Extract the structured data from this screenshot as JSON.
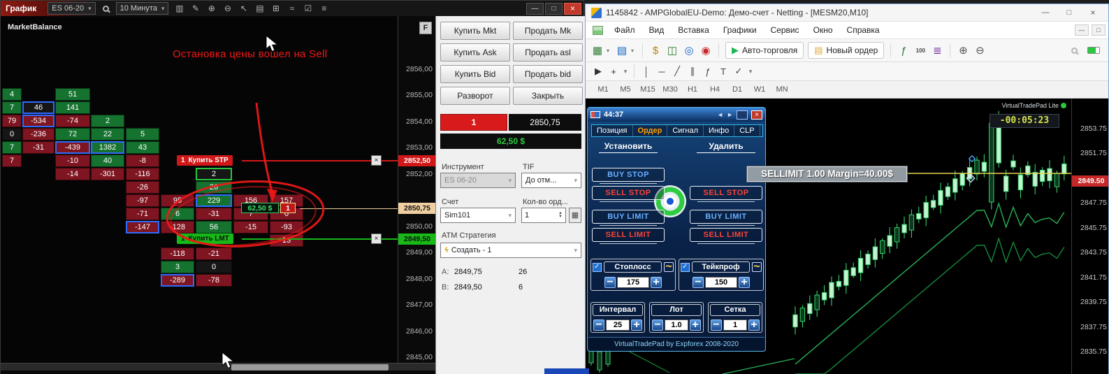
{
  "colors": {
    "annotation_red": "#f01818",
    "pnl_green": "#2ecc40",
    "buy_blue": "#6ab0ff",
    "sell_red": "#ff4438",
    "stp_red": "#d01818",
    "lmt_green": "#17b817",
    "marker_tan": "#f0d0a0",
    "cell_green": "#15722f",
    "cell_red": "#7e1520",
    "highlight_blue": "#2f6bff",
    "mt5_candle_green": "#35d06a",
    "countdown_yellow": "#d7e34d"
  },
  "left_window": {
    "title": "График",
    "instrument": "ES 06-20",
    "timeframe": "10 Минута",
    "panel_label": "MarketBalance",
    "f_button": "F",
    "annotation": "Остановка цены вошел на Sell",
    "tool_icons": [
      {
        "name": "chart-style-icon",
        "glyph": "▥"
      },
      {
        "name": "draw-icon",
        "glyph": "✎"
      },
      {
        "name": "zoom-in-icon",
        "glyph": "⊕"
      },
      {
        "name": "zoom-out-icon",
        "glyph": "⊖"
      },
      {
        "name": "pointer-icon",
        "glyph": "↖"
      },
      {
        "name": "report-icon",
        "glyph": "▤"
      },
      {
        "name": "window-grid-icon",
        "glyph": "⊞"
      },
      {
        "name": "indicator-icon",
        "glyph": "≈"
      },
      {
        "name": "region-icon",
        "glyph": "☑"
      },
      {
        "name": "list-icon",
        "glyph": "≡"
      }
    ],
    "axis_prices": [
      "2856,00",
      "2855,00",
      "2854,00",
      "2853,00",
      "2852,00",
      "2850,00",
      "2849,00",
      "2848,00",
      "2847,00",
      "2846,00",
      "2845,00"
    ],
    "markers": {
      "stp_qty": "1",
      "stp_label": "Купить STP",
      "stp_price": "2852,50",
      "current_price": "2850,75",
      "lmt_qty": "1",
      "lmt_label": "Купить LMT",
      "lmt_price": "2849,50",
      "tooltip_pnl": "62,50 $",
      "tooltip_qty": "1"
    },
    "cells": [
      {
        "v": "4",
        "c": 0,
        "r": 0,
        "k": "g"
      },
      {
        "v": "51",
        "c": 2,
        "r": 0,
        "k": "g"
      },
      {
        "v": "7",
        "c": 0,
        "r": 1,
        "k": "g"
      },
      {
        "v": "46",
        "c": 1,
        "r": 1,
        "k": "d",
        "b": 1
      },
      {
        "v": "141",
        "c": 2,
        "r": 1,
        "k": "g"
      },
      {
        "v": "79",
        "c": 0,
        "r": 2,
        "k": "r"
      },
      {
        "v": "-534",
        "c": 1,
        "r": 2,
        "k": "r",
        "b": 1
      },
      {
        "v": "-74",
        "c": 2,
        "r": 2,
        "k": "r"
      },
      {
        "v": "2",
        "c": 3,
        "r": 2,
        "k": "g"
      },
      {
        "v": "0",
        "c": 0,
        "r": 3,
        "k": "d"
      },
      {
        "v": "-236",
        "c": 1,
        "r": 3,
        "k": "r"
      },
      {
        "v": "72",
        "c": 2,
        "r": 3,
        "k": "g"
      },
      {
        "v": "22",
        "c": 3,
        "r": 3,
        "k": "g"
      },
      {
        "v": "5",
        "c": 4,
        "r": 3,
        "k": "g"
      },
      {
        "v": "7",
        "c": 0,
        "r": 4,
        "k": "g"
      },
      {
        "v": "-31",
        "c": 1,
        "r": 4,
        "k": "r"
      },
      {
        "v": "-439",
        "c": 2,
        "r": 4,
        "k": "r",
        "b": 1
      },
      {
        "v": "1382",
        "c": 3,
        "r": 4,
        "k": "g",
        "b": 1
      },
      {
        "v": "43",
        "c": 4,
        "r": 4,
        "k": "g"
      },
      {
        "v": "7",
        "c": 0,
        "r": 5,
        "k": "r"
      },
      {
        "v": "-10",
        "c": 2,
        "r": 5,
        "k": "r"
      },
      {
        "v": "40",
        "c": 3,
        "r": 5,
        "k": "g"
      },
      {
        "v": "-8",
        "c": 4,
        "r": 5,
        "k": "r"
      },
      {
        "v": "-14",
        "c": 2,
        "r": 6,
        "k": "r"
      },
      {
        "v": "-301",
        "c": 3,
        "r": 6,
        "k": "r"
      },
      {
        "v": "-116",
        "c": 4,
        "r": 6,
        "k": "r"
      },
      {
        "v": "2",
        "c": 6,
        "r": 6,
        "k": "d",
        "gb": 1
      },
      {
        "v": "-26",
        "c": 4,
        "r": 7,
        "k": "r"
      },
      {
        "v": "26",
        "c": 6,
        "r": 7,
        "k": "g"
      },
      {
        "v": "-97",
        "c": 4,
        "r": 8,
        "k": "r"
      },
      {
        "v": "95",
        "c": 5,
        "r": 8,
        "k": "r"
      },
      {
        "v": "229",
        "c": 6,
        "r": 8,
        "k": "g",
        "b": 1
      },
      {
        "v": "156",
        "c": 7,
        "r": 8,
        "k": "r"
      },
      {
        "v": "157",
        "c": 8,
        "r": 8,
        "k": "r"
      },
      {
        "v": "-71",
        "c": 4,
        "r": 9,
        "k": "r"
      },
      {
        "v": "6",
        "c": 5,
        "r": 9,
        "k": "g"
      },
      {
        "v": "-31",
        "c": 6,
        "r": 9,
        "k": "r"
      },
      {
        "v": "7",
        "c": 7,
        "r": 9,
        "k": "r"
      },
      {
        "v": "0",
        "c": 8,
        "r": 9,
        "k": "r"
      },
      {
        "v": "-147",
        "c": 4,
        "r": 10,
        "k": "r",
        "b": 1
      },
      {
        "v": "-128",
        "c": 5,
        "r": 10,
        "k": "r"
      },
      {
        "v": "56",
        "c": 6,
        "r": 10,
        "k": "g"
      },
      {
        "v": "-15",
        "c": 7,
        "r": 10,
        "k": "r"
      },
      {
        "v": "-93",
        "c": 8,
        "r": 10,
        "k": "r"
      },
      {
        "v": "13",
        "c": 8,
        "r": 11,
        "k": "r"
      },
      {
        "v": "-118",
        "c": 5,
        "r": 12,
        "k": "r"
      },
      {
        "v": "-21",
        "c": 6,
        "r": 12,
        "k": "r"
      },
      {
        "v": "3",
        "c": 5,
        "r": 13,
        "k": "g"
      },
      {
        "v": "0",
        "c": 6,
        "r": 13,
        "k": "d"
      },
      {
        "v": "-289",
        "c": 5,
        "r": 14,
        "k": "r",
        "b": 1
      },
      {
        "v": "-78",
        "c": 6,
        "r": 14,
        "k": "r"
      }
    ],
    "order_panel": {
      "buttons": [
        "Купить Mkt",
        "Продать Mk",
        "Купить Ask",
        "Продать asl",
        "Купить Bid",
        "Продать bid",
        "Разворот",
        "Закрыть"
      ],
      "qty": "1",
      "price": "2850,75",
      "pnl": "62,50 $",
      "instrument_label": "Инструмент",
      "tif_label": "TIF",
      "instrument_value": "ES 06-20",
      "tif_value": "До отм...",
      "account_label": "Счет",
      "orders_label": "Кол-во орд...",
      "account_value": "Sim101",
      "orders_value": "1",
      "atm_label": "ATM Стратегия",
      "atm_value": "Создать - 1",
      "ask_label": "A:",
      "ask_price": "2849,75",
      "ask_size": "26",
      "bid_label": "B:",
      "bid_price": "2849,50",
      "bid_size": "6"
    }
  },
  "mt5_window": {
    "title": "1145842 - AMPGlobalEU-Demo: Демо-счет - Netting - [MESM20,M10]",
    "menu": [
      "Файл",
      "Вид",
      "Вставка",
      "Графики",
      "Сервис",
      "Окно",
      "Справка"
    ],
    "toolbar": [
      {
        "name": "new-chart-icon",
        "glyph": "▦",
        "color": "#2e7d32",
        "dd": true
      },
      {
        "name": "profiles-icon",
        "glyph": "▤",
        "color": "#1565c0",
        "dd": true
      },
      {
        "name": "sep"
      },
      {
        "name": "market-watch-icon",
        "glyph": "$",
        "color": "#b8860b"
      },
      {
        "name": "data-window-icon",
        "glyph": "◫",
        "color": "#2e7d32"
      },
      {
        "name": "navigator-icon",
        "glyph": "◎",
        "color": "#1565c0"
      },
      {
        "name": "signals-icon",
        "glyph": "◉",
        "color": "#c62828"
      },
      {
        "name": "sep"
      },
      {
        "name": "autotrade-button",
        "label": "Авто-торговля",
        "glyph": "▶",
        "color": "#1db954"
      },
      {
        "name": "new-order-button",
        "label": "Новый ордер",
        "glyph": "▤",
        "color": "#e0a93e"
      },
      {
        "name": "sep"
      },
      {
        "name": "indicators-icon",
        "glyph": "ƒ",
        "color": "#2e7d32"
      },
      {
        "name": "periods-icon",
        "glyph": "100",
        "color": "#444",
        "small": true
      },
      {
        "name": "templates-icon",
        "glyph": "≣",
        "color": "#6a1b9a"
      },
      {
        "name": "sep"
      },
      {
        "name": "zoom-in-icon",
        "glyph": "⊕",
        "color": "#555"
      },
      {
        "name": "zoom-out-icon",
        "glyph": "⊖",
        "color": "#555"
      }
    ],
    "drawbar": [
      {
        "name": "cursor-icon",
        "glyph": "▶",
        "color": "#333"
      },
      {
        "name": "crosshair-icon",
        "glyph": "+",
        "color": "#333"
      },
      {
        "name": "caret-icon",
        "glyph": "▾",
        "small": true
      },
      {
        "name": "sep"
      },
      {
        "name": "vline-icon",
        "glyph": "│"
      },
      {
        "name": "hline-icon",
        "glyph": "─"
      },
      {
        "name": "trendline-icon",
        "glyph": "╱"
      },
      {
        "name": "channel-icon",
        "glyph": "∥"
      },
      {
        "name": "fibo-icon",
        "glyph": "ƒ"
      },
      {
        "name": "text-icon",
        "glyph": "T"
      },
      {
        "name": "arrows-icon",
        "glyph": "✓"
      },
      {
        "name": "caret-icon",
        "glyph": "▾",
        "small": true
      }
    ],
    "timeframes": [
      "M1",
      "M5",
      "M15",
      "M30",
      "H1",
      "H4",
      "D1",
      "W1",
      "MN"
    ],
    "axis_prices": [
      "2853.75",
      "2851.75",
      "2847.75",
      "2845.75",
      "2843.75",
      "2841.75",
      "2839.75",
      "2837.75",
      "2835.75"
    ],
    "current_price": "2849.50",
    "countdown": "-00:05:23",
    "vtp_lite": "VirtualTradePad Lite",
    "sellimit_text": "SELLIMIT 1.00 Margin=40.00$",
    "vtp": {
      "timer": "44:37",
      "tabs": [
        "Позиция",
        "Ордер",
        "Сигнал",
        "Инфо",
        "CLP"
      ],
      "active_tab_index": 1,
      "set_header": "Установить",
      "del_header": "Удалить",
      "set_buttons": [
        "BUY STOP",
        "SELL STOP",
        "BUY LIMIT",
        "SELL LIMIT"
      ],
      "del_buttons": [
        "SELL STOP",
        "BUY LIMIT",
        "SELL LIMIT"
      ],
      "sl_label": "Стоплосс",
      "sl_value": "175",
      "tp_label": "Тейкпроф",
      "tp_value": "150",
      "interval_label": "Интервал",
      "interval_value": "25",
      "lot_label": "Лот",
      "lot_value": "1.0",
      "grid_label": "Сетка",
      "grid_value": "1",
      "footer": "VirtualTradePad by Expforex 2008-2020"
    }
  }
}
